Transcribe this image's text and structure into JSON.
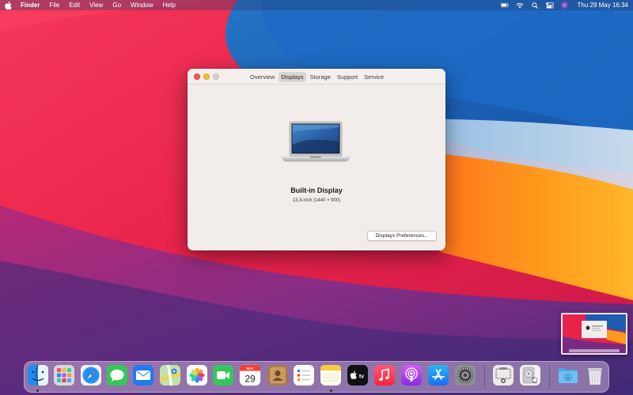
{
  "menubar": {
    "app_name": "Finder",
    "items": [
      "File",
      "Edit",
      "View",
      "Go",
      "Window",
      "Help"
    ],
    "clock": "Thu 29 May  16:34",
    "status_icons": [
      "battery-icon",
      "wifi-icon",
      "search-icon",
      "control-center-icon",
      "siri-icon"
    ]
  },
  "window": {
    "tabs": [
      "Overview",
      "Displays",
      "Storage",
      "Support",
      "Service"
    ],
    "active_tab": "Displays",
    "display_name": "Built-in Display",
    "display_spec": "13,3-inch (1440 × 900)",
    "button_label": "Displays Preferences..."
  },
  "dock": {
    "calendar_month": "MAY",
    "calendar_day": "29",
    "tv_label": "tv",
    "items": [
      "Finder",
      "Launchpad",
      "Safari",
      "Messages",
      "Mail",
      "Maps",
      "Photos",
      "FaceTime",
      "Calendar",
      "Contacts",
      "Reminders",
      "Notes",
      "TV",
      "Music",
      "Podcasts",
      "App Store",
      "System Preferences",
      "Screenshot",
      "Disk Utility",
      "Downloads",
      "Trash"
    ]
  },
  "colors": {
    "accent_red": "#ee5d55",
    "accent_yellow": "#f5bd3c",
    "window_bg": "#f2edea"
  }
}
